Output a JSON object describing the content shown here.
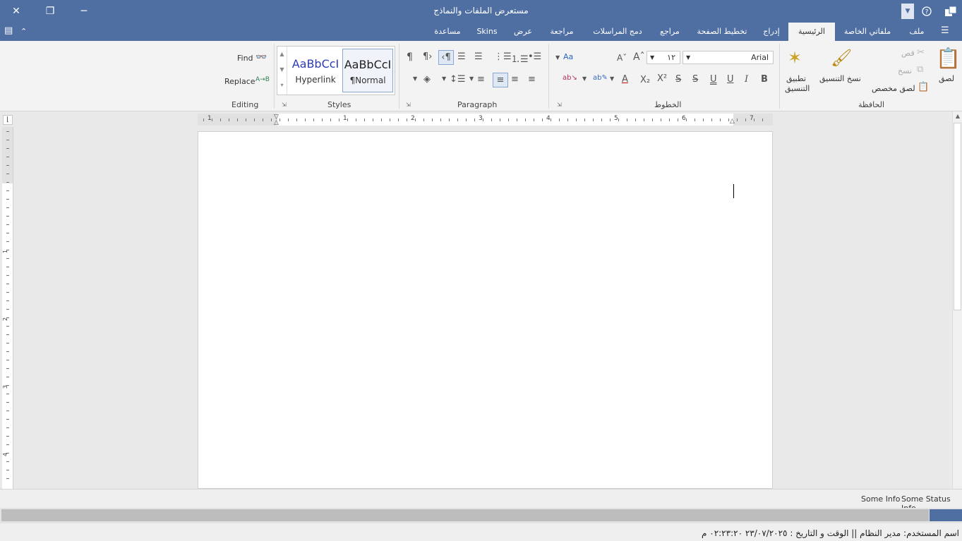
{
  "window": {
    "title": "مستعرض الملفات والنماذج",
    "help_icon": "help-circle-icon",
    "app_icon": "app-logo-icon"
  },
  "tabs": {
    "file": "ملف",
    "my_files": "ملفاتي الخاصة",
    "home": "الرئيسية",
    "insert": "إدراج",
    "layout": "تخطيط الصفحة",
    "references": "مراجع",
    "mailings": "دمج المراسلات",
    "review": "مراجعة",
    "view": "عرض",
    "skins": "Skins",
    "help": "مساعدة"
  },
  "ribbon": {
    "clipboard": {
      "label": "الحافظة",
      "paste": "لصق",
      "cut": "قص",
      "copy": "نسخ",
      "paste_special": "لصق مخصص",
      "format_painter": "نسخ التنسيق",
      "apply_format_line1": "تطبيق",
      "apply_format_line2": "التنسيق"
    },
    "font": {
      "label": "الخطوط",
      "font_name": "Arial",
      "font_size": "١٢"
    },
    "paragraph": {
      "label": "Paragraph"
    },
    "styles": {
      "label": "Styles",
      "items": [
        {
          "sample": "AaBbCcI",
          "name": "Hyperlink"
        },
        {
          "sample": "AaBbCcI",
          "name": "¶Normal"
        }
      ]
    },
    "editing": {
      "label": "Editing",
      "find": "Find",
      "replace": "Replace"
    }
  },
  "ruler": {
    "h_numbers": [
      "1",
      "1",
      "2",
      "3",
      "4",
      "5",
      "6",
      "7"
    ],
    "v_numbers": [
      "1",
      "2",
      "3",
      "4"
    ]
  },
  "statusbar": {
    "info": "Some Info",
    "status_info": "Some Status Info"
  },
  "progress": {
    "value_fraction": 0.034
  },
  "footer": {
    "text": "اسم المستخدم:  مدير  النظام  ||  الوقت و التاريخ : ٢٣/٠٧/٢٠٢٥ ٠٢:٢٣:٢٠ م"
  },
  "colors": {
    "titlebar": "#4f6fa2",
    "ribbon": "#f3f3f3",
    "page": "#ffffff",
    "hyperlink": "#2e3bb5"
  }
}
